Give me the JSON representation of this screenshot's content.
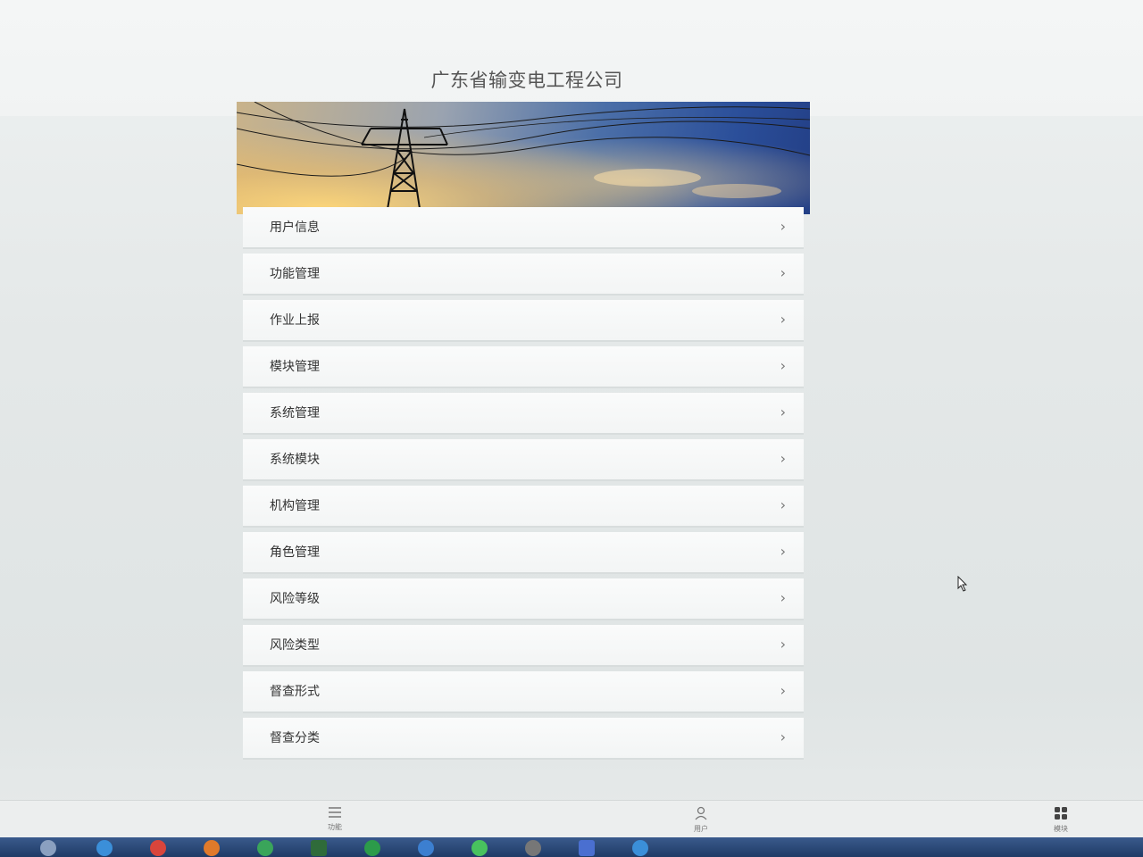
{
  "header": {
    "title": "广东省输变电工程公司"
  },
  "menu": {
    "items": [
      {
        "label": "用户信息"
      },
      {
        "label": "功能管理"
      },
      {
        "label": "作业上报"
      },
      {
        "label": "模块管理"
      },
      {
        "label": "系统管理"
      },
      {
        "label": "系统模块"
      },
      {
        "label": "机构管理"
      },
      {
        "label": "角色管理"
      },
      {
        "label": "风险等级"
      },
      {
        "label": "风险类型"
      },
      {
        "label": "督查形式"
      },
      {
        "label": "督查分类"
      }
    ],
    "chevron": "›"
  },
  "tabbar": {
    "tabs": [
      {
        "label": "功能",
        "icon": "menu-lines-icon"
      },
      {
        "label": "用户",
        "icon": "user-icon"
      },
      {
        "label": "模块",
        "icon": "grid-icon"
      }
    ]
  },
  "colors": {
    "banner_sky": "#2b4f9a",
    "banner_sun": "#f0c064",
    "menu_bg": "#f7f8f8",
    "taskbar": "#1f3b66"
  }
}
